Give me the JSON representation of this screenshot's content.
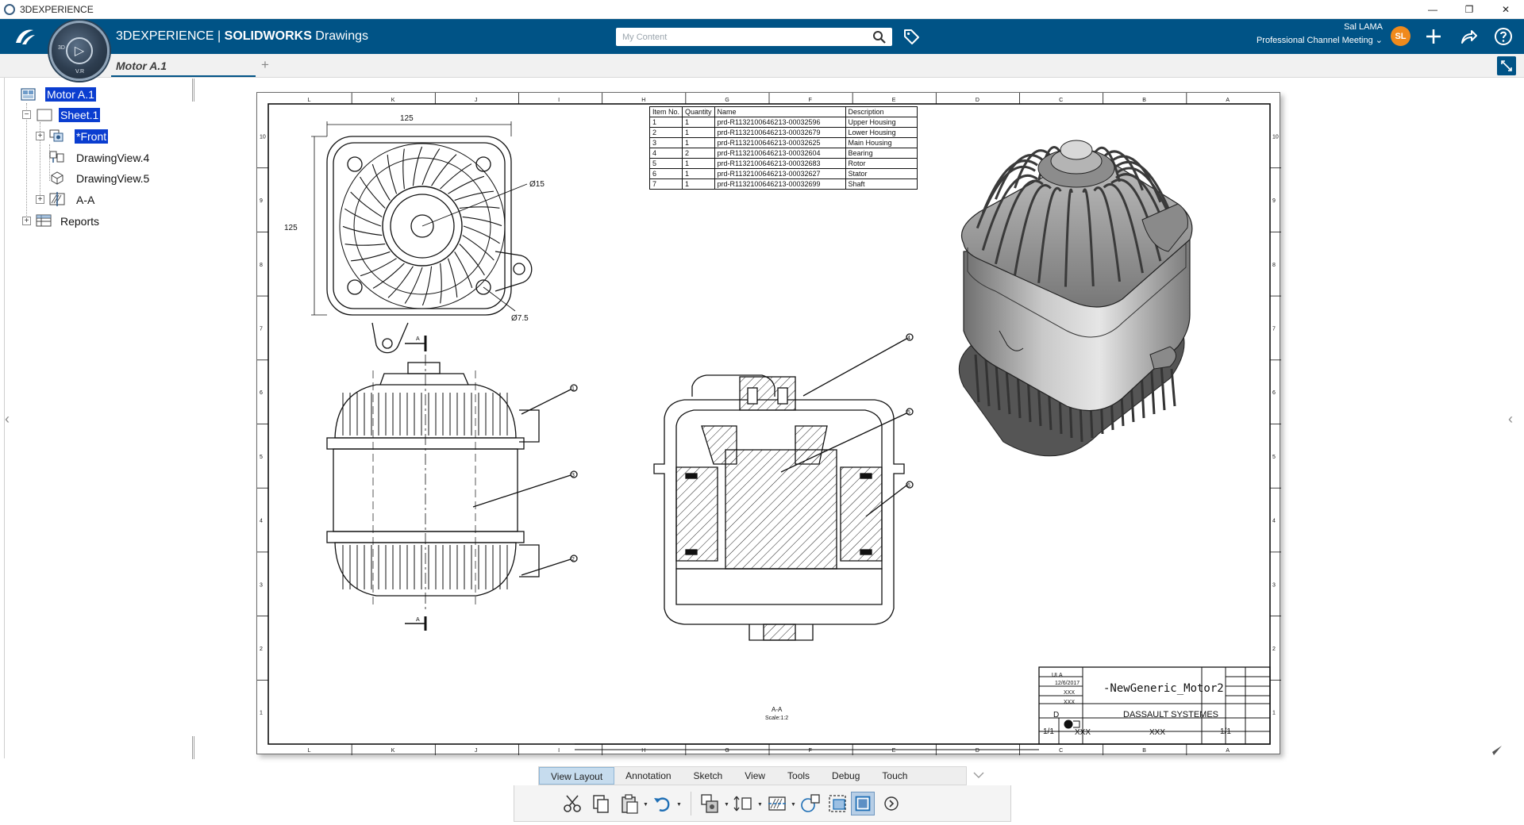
{
  "window": {
    "title": "3DEXPERIENCE",
    "controls": [
      "—",
      "❐",
      "✕"
    ]
  },
  "topbar": {
    "brand": "3DEXPERIENCE | ",
    "app_bold": "SOLIDWORKS",
    "app_rest": " Drawings",
    "compass_labels": [
      "3D",
      "V.R"
    ],
    "search_placeholder": "My Content",
    "user_name": "Sal LAMA",
    "user_context": "Professional Channel Meeting ⌄",
    "avatar_initials": "SL",
    "brand_color": "#005386"
  },
  "tabs": {
    "active_label": "Motor A.1",
    "add_label": "+"
  },
  "tree": {
    "items": [
      {
        "label": "Motor A.1",
        "selected": true
      },
      {
        "label": "Sheet.1",
        "selected": true
      },
      {
        "label": "*Front",
        "selected": true
      },
      {
        "label": "DrawingView.4",
        "selected": false
      },
      {
        "label": "DrawingView.5",
        "selected": false
      },
      {
        "label": "A-A",
        "selected": false
      },
      {
        "label": "Reports",
        "selected": false
      }
    ]
  },
  "drawing": {
    "border_letters": [
      "L",
      "K",
      "J",
      "I",
      "H",
      "G",
      "F",
      "E",
      "D",
      "C",
      "B",
      "A"
    ],
    "border_numbers": [
      "10",
      "9",
      "8",
      "7",
      "6",
      "5",
      "4",
      "3",
      "2",
      "1"
    ],
    "dim_width": "125",
    "dim_height": "125",
    "dim_dia_15": "Ø15",
    "dim_dia_7_5": "Ø7.5",
    "section_label": "A",
    "section_caption": "A-A",
    "section_scale": "Scale:1:2",
    "balloons": [
      "1",
      "3",
      "2",
      "4",
      "5",
      "6"
    ],
    "bom": {
      "headers": [
        "Item No.",
        "Quantity",
        "Name",
        "Description"
      ],
      "rows": [
        [
          "1",
          "1",
          "prd-R1132100646213-00032596",
          "Upper Housing"
        ],
        [
          "2",
          "1",
          "prd-R1132100646213-00032679",
          "Lower Housing"
        ],
        [
          "3",
          "1",
          "prd-R1132100646213-00032625",
          "Main Housing"
        ],
        [
          "4",
          "2",
          "prd-R1132100646213-00032604",
          "Bearing"
        ],
        [
          "5",
          "1",
          "prd-R1132100646213-00032683",
          "Rotor"
        ],
        [
          "6",
          "1",
          "prd-R1132100646213-00032627",
          "Stator"
        ],
        [
          "7",
          "1",
          "prd-R1132100646213-00032699",
          "Shaft"
        ]
      ]
    },
    "title_block": {
      "drawing_name": "-NewGeneric_Motor2",
      "company": "DASSAULT SYSTEMES",
      "designer": "ULA",
      "date": "12/6/2017",
      "check": "XXX",
      "approved": "XXX",
      "size": "D",
      "scale": "1/1",
      "weight": "XXX",
      "sheet": "1/1",
      "number": "XXX"
    }
  },
  "commands": {
    "tabs": [
      "View Layout",
      "Annotation",
      "Sketch",
      "View",
      "Tools",
      "Debug",
      "Touch"
    ],
    "active_tab": "View Layout"
  }
}
